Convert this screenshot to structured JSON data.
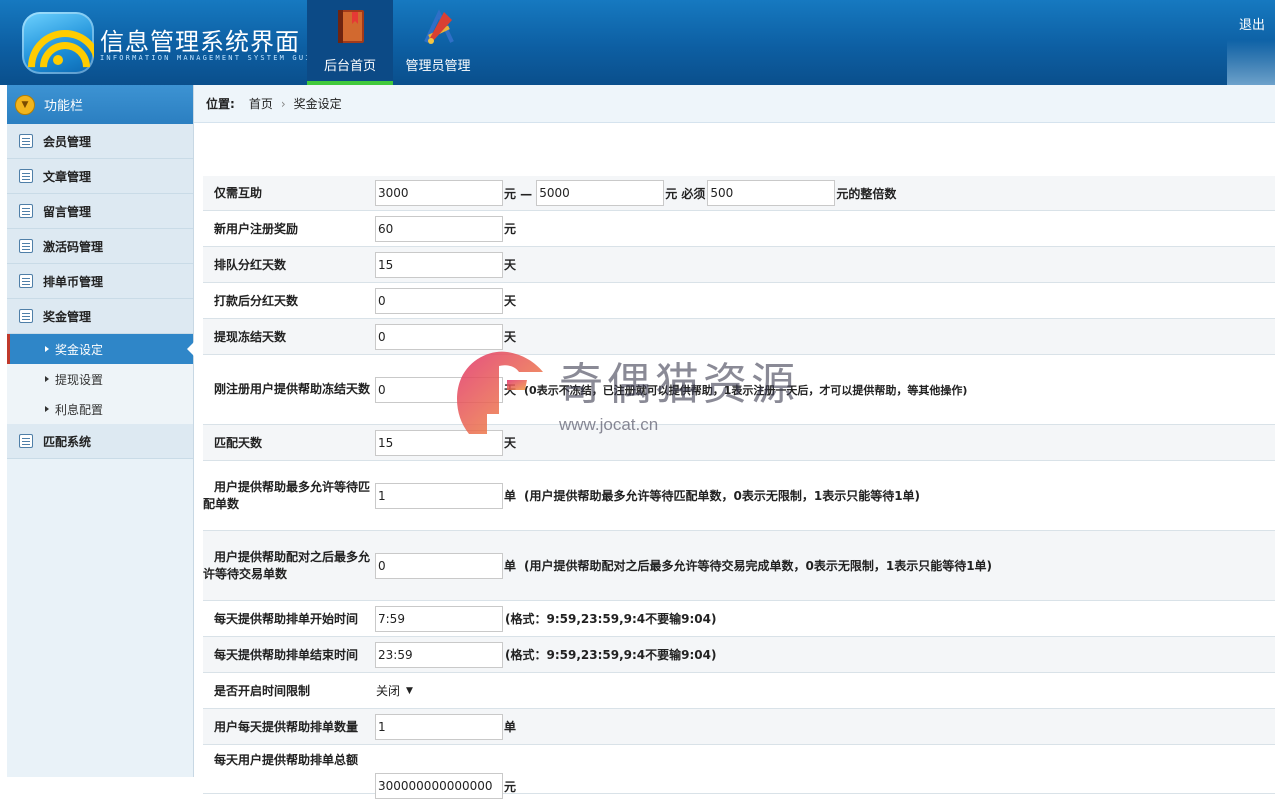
{
  "header": {
    "title": "信息管理系统界面",
    "subtitle": "INFORMATION MANAGEMENT SYSTEM GUI",
    "nav": [
      {
        "label": "后台首页",
        "icon": "book-icon",
        "active": true
      },
      {
        "label": "管理员管理",
        "icon": "tools-icon",
        "active": false
      }
    ],
    "logout": "退出"
  },
  "sidebar": {
    "title": "功能栏",
    "items": [
      {
        "label": "会员管理",
        "icon": "list-icon"
      },
      {
        "label": "文章管理",
        "icon": "edit-icon"
      },
      {
        "label": "留言管理",
        "icon": "edit-icon"
      },
      {
        "label": "激活码管理",
        "icon": "calendar-icon"
      },
      {
        "label": "排单币管理",
        "icon": "calendar-icon"
      },
      {
        "label": "奖金管理",
        "icon": "calendar-icon"
      }
    ],
    "subitems": [
      {
        "label": "奖金设定",
        "active": true
      },
      {
        "label": "提现设置",
        "active": false
      },
      {
        "label": "利息配置",
        "active": false
      }
    ],
    "last_item": {
      "label": "匹配系统",
      "icon": "calendar-icon"
    }
  },
  "breadcrumb": {
    "prefix": "位置:",
    "items": [
      "首页",
      "奖金设定"
    ],
    "separator": "›"
  },
  "form": {
    "help_range": {
      "label": "仅需互助",
      "min": "3000",
      "dash": "元 —",
      "max": "5000",
      "must": "元 必须",
      "multiple": "500",
      "tail": "元的整倍数"
    },
    "new_user_reward": {
      "label": "新用户注册奖励",
      "value": "60",
      "unit": "元"
    },
    "queue_dividend_days": {
      "label": "排队分红天数",
      "value": "15",
      "unit": "天"
    },
    "post_payment_dividend_days": {
      "label": "打款后分红天数",
      "value": "0",
      "unit": "天"
    },
    "withdraw_freeze_days": {
      "label": "提现冻结天数",
      "value": "0",
      "unit": "天"
    },
    "new_user_freeze_days": {
      "label": "刚注册用户提供帮助冻结天数",
      "value": "0",
      "unit": "天",
      "note": "(0表示不冻结，已注册就可以提供帮助，1表示注册一天后，才可以提供帮助，等其他操作)"
    },
    "match_days": {
      "label": "匹配天数",
      "value": "15",
      "unit": "天"
    },
    "max_waiting_match": {
      "label": "用户提供帮助最多允许等待匹配单数",
      "value": "1",
      "unit": "单",
      "note": "(用户提供帮助最多允许等待匹配单数，0表示无限制，1表示只能等待1单)"
    },
    "max_waiting_trade": {
      "label": "用户提供帮助配对之后最多允许等待交易单数",
      "value": "0",
      "unit": "单",
      "note": "(用户提供帮助配对之后最多允许等待交易完成单数，0表示无限制，1表示只能等待1单)"
    },
    "daily_start_time": {
      "label": "每天提供帮助排单开始时间",
      "value": "7:59",
      "note": "(格式：9:59,23:59,9:4不要输9:04)"
    },
    "daily_end_time": {
      "label": "每天提供帮助排单结束时间",
      "value": "23:59",
      "note": "(格式：9:59,23:59,9:4不要输9:04)"
    },
    "time_limit": {
      "label": "是否开启时间限制",
      "selected": "关闭"
    },
    "daily_user_count": {
      "label": "用户每天提供帮助排单数量",
      "value": "1",
      "unit": "单"
    },
    "daily_total_amount": {
      "label": "每天用户提供帮助排单总额",
      "value": "300000000000000",
      "unit": "元"
    }
  },
  "watermark": {
    "text": "奇偶猫资源",
    "url": "www.jocat.cn"
  },
  "colors": {
    "header": "#0d5fa3",
    "active_nav": "#0c4a86",
    "nav_underline": "#41c93c",
    "sidebar_active": "#2f86c8",
    "active_marker": "#c0392b"
  }
}
